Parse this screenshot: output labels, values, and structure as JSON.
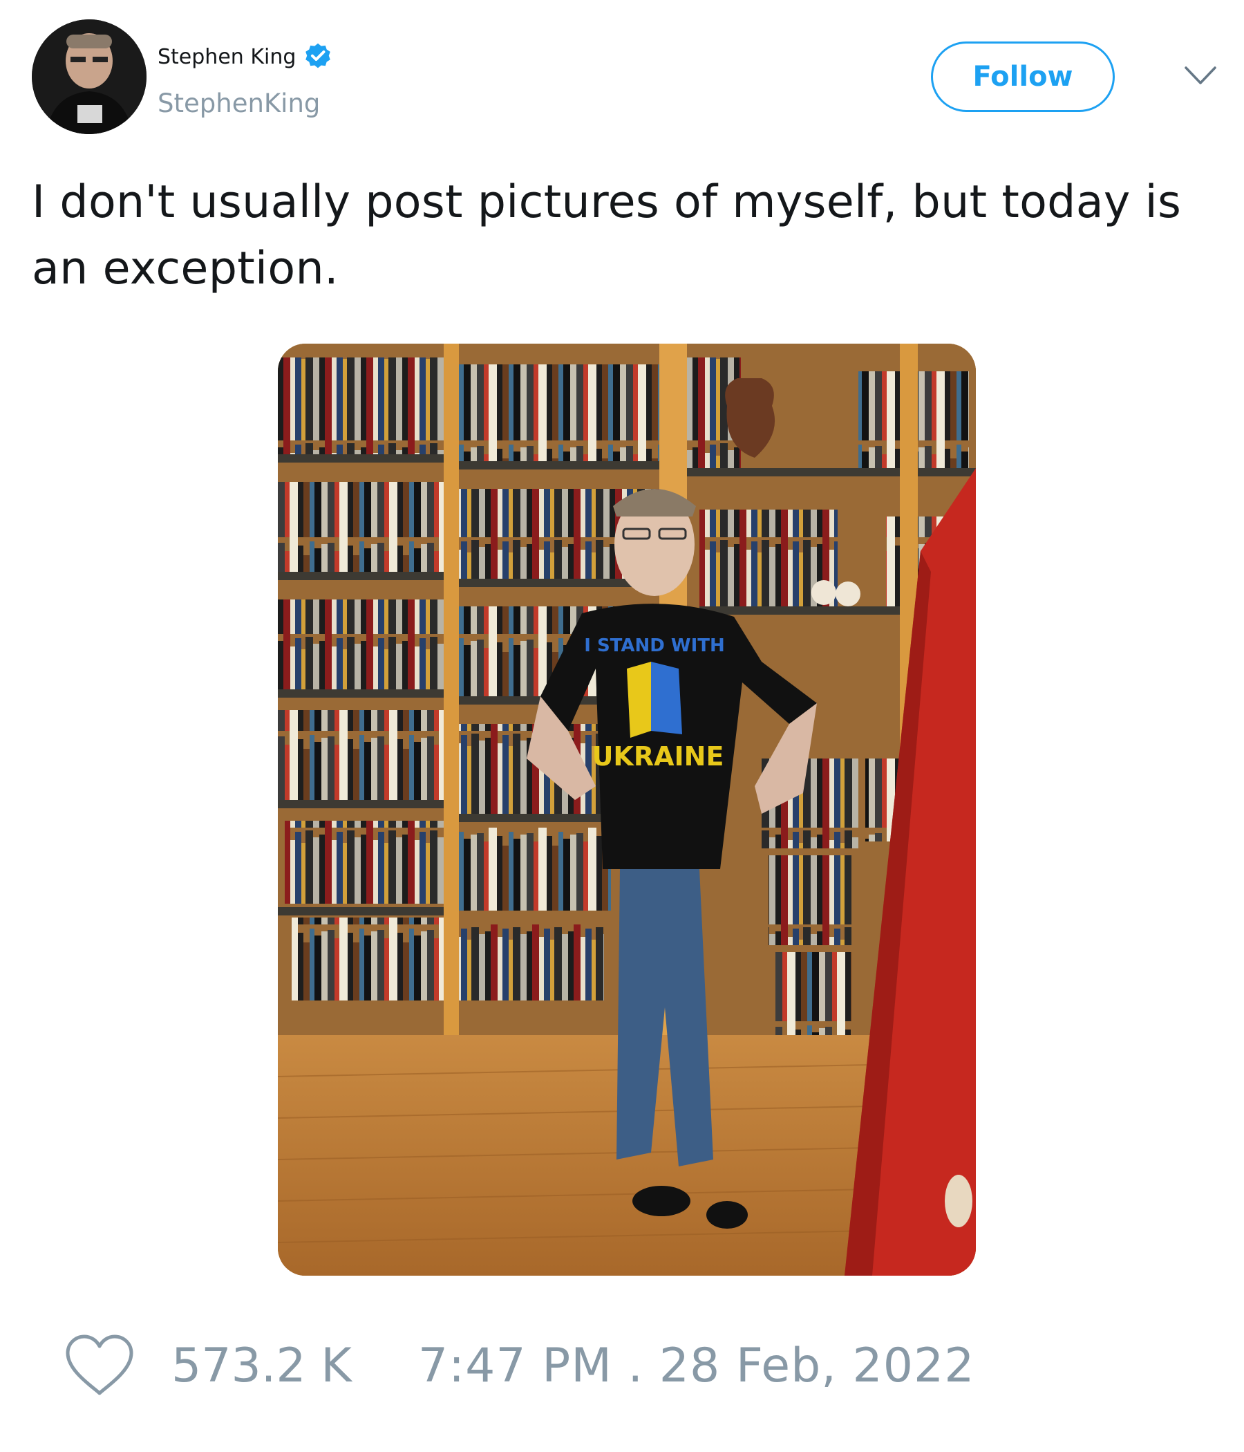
{
  "tweet": {
    "author": {
      "display_name": "Stephen King",
      "handle": "StephenKing",
      "verified": true,
      "avatar_icon": "profile-photo"
    },
    "follow_label": "Follow",
    "menu_icon": "chevron-down-icon",
    "text": "I don't usually post pictures of myself, but today is an exception.",
    "photo": {
      "shirt_text_top": "I STAND WITH",
      "shirt_text_bottom": "UKRAINE"
    },
    "likes": "573.2 K",
    "timestamp": "7:47 PM . 28 Feb, 2022"
  },
  "colors": {
    "accent": "#1da1f2",
    "muted": "#8899a6",
    "text": "#14171a",
    "ukraine_blue": "#2f6fd0",
    "ukraine_yellow": "#e8c81a"
  }
}
